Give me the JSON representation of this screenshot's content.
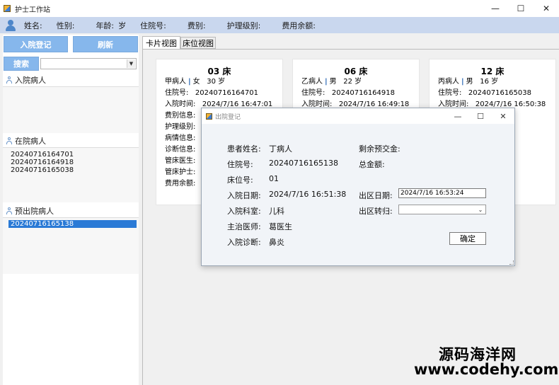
{
  "window": {
    "title": "护士工作站",
    "controls": [
      "—",
      "☐",
      "✕"
    ]
  },
  "infobar": {
    "name_label": "姓名:",
    "gender_label": "性别:",
    "age_label": "年龄:",
    "age_unit": "岁",
    "admission_no_label": "住院号:",
    "fee_type_label": "费别:",
    "nursing_level_label": "护理级别:",
    "balance_label": "费用余额:"
  },
  "left": {
    "admit_button": "入院登记",
    "refresh_button": "刷新",
    "search_button": "搜索",
    "sections": [
      {
        "title": "入院病人",
        "items": []
      },
      {
        "title": "在院病人",
        "items": [
          "20240716164701",
          "20240716164918",
          "20240716165038"
        ]
      },
      {
        "title": "预出院病人",
        "items": [
          "20240716165138"
        ]
      }
    ]
  },
  "tabs": [
    {
      "label": "卡片视图",
      "active": true
    },
    {
      "label": "床位视图",
      "active": false
    }
  ],
  "cards": [
    {
      "bed": "03 床",
      "name": "甲病人",
      "gender": "女",
      "age": "30 岁",
      "admission_no_label": "住院号:",
      "admission_no": "20240716164701",
      "admit_time_label": "入院时间:",
      "admit_time": "2024/7/16 16:47:01",
      "other_labels": [
        "费别信息:",
        "护理级别:",
        "病情信息:",
        "诊断信息:",
        "管床医生:",
        "管床护士:",
        "费用余额:"
      ]
    },
    {
      "bed": "06 床",
      "name": "乙病人",
      "gender": "男",
      "age": "22 岁",
      "admission_no_label": "住院号:",
      "admission_no": "20240716164918",
      "admit_time_label": "入院时间:",
      "admit_time": "2024/7/16 16:49:18"
    },
    {
      "bed": "12 床",
      "name": "丙病人",
      "gender": "男",
      "age": "16 岁",
      "admission_no_label": "住院号:",
      "admission_no": "20240716165038",
      "admit_time_label": "入院时间:",
      "admit_time": "2024/7/16 16:50:38"
    }
  ],
  "dialog": {
    "title": "出院登记",
    "patient_name_label": "患者姓名:",
    "patient_name": "丁病人",
    "admission_no_label": "住院号:",
    "admission_no": "20240716165138",
    "bed_no_label": "床位号:",
    "bed_no": "01",
    "admit_date_label": "入院日期:",
    "admit_date": "2024/7/16 16:51:38",
    "dept_label": "入院科室:",
    "dept": "儿科",
    "doctor_label": "主治医师:",
    "doctor": "葛医生",
    "diagnosis_label": "入院诊断:",
    "diagnosis": "鼻炎",
    "deposit_label": "剩余预交金:",
    "total_label": "总金额:",
    "discharge_date_label": "出区日期:",
    "discharge_date": "2024/7/16 16:53:24",
    "discharge_dest_label": "出区转归:",
    "discharge_dest": "",
    "ok_button": "确定"
  },
  "watermark": {
    "line1": "源码海洋网",
    "line2": "www.codehy.com"
  }
}
